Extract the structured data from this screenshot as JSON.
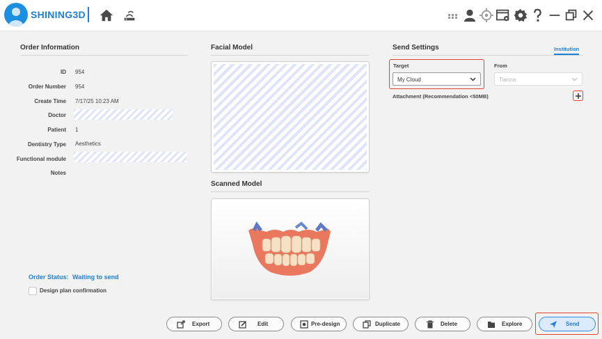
{
  "header": {
    "brand": "SHINING3D",
    "icons": [
      "home-icon",
      "cloud-router-icon",
      "grid-icon",
      "user-icon",
      "target-icon",
      "window-settings-icon",
      "gear-icon",
      "help-icon",
      "minimize-icon",
      "restore-icon",
      "close-icon"
    ]
  },
  "order_info": {
    "title": "Order Information",
    "fields": [
      {
        "label": "ID",
        "value": "954"
      },
      {
        "label": "Order Number",
        "value": "954"
      },
      {
        "label": "Create Time",
        "value": "7/17/25 10:23 AM"
      },
      {
        "label": "Doctor",
        "value": ""
      },
      {
        "label": "Patient",
        "value": "1"
      },
      {
        "label": "Dentistry Type",
        "value": "Aesthetics"
      },
      {
        "label": "Functional module",
        "value": ""
      },
      {
        "label": "Notes",
        "value": ""
      }
    ],
    "status_label": "Order Status:",
    "status_value": "Waiting to send",
    "confirm_label": "Design plan confirmation"
  },
  "facial_model": {
    "title": "Facial Model"
  },
  "scanned_model": {
    "title": "Scanned Model"
  },
  "send_settings": {
    "title": "Send Settings",
    "tab": "Institution",
    "target_label": "Target",
    "target_value": "My Cloud",
    "from_label": "From",
    "from_value": "Tianna",
    "attachment_label": "Attachment (Recommendation <50MB)"
  },
  "toolbar": {
    "export": "Export",
    "edit": "Edit",
    "predesign": "Pre-design",
    "duplicate": "Duplicate",
    "delete": "Delete",
    "explore": "Explore",
    "send": "Send"
  },
  "colors": {
    "accent": "#1d7fd6",
    "highlight": "#e0442c"
  }
}
